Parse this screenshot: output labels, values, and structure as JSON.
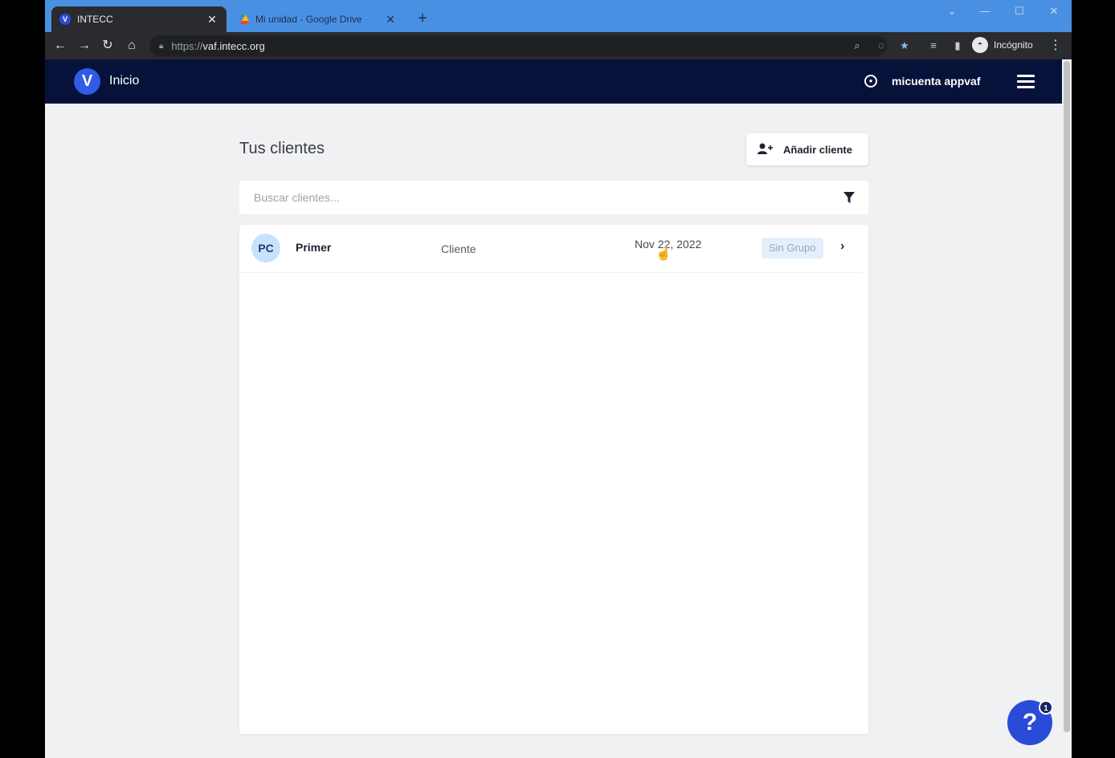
{
  "browser": {
    "tabs": [
      {
        "title": "INTECC",
        "favicon": "V"
      },
      {
        "title": "Mi unidad - Google Drive"
      }
    ],
    "url": {
      "protocol": "https://",
      "host": "vaf.intecc.org"
    },
    "incognito_label": "Incógnito"
  },
  "app": {
    "logo_letter": "V",
    "title": "Inicio",
    "user_name": "micuenta appvaf"
  },
  "main": {
    "page_title": "Tus clientes",
    "add_button_label": "Añadir cliente",
    "search_placeholder": "Buscar clientes...",
    "clients": [
      {
        "initials": "PC",
        "name": "Primer",
        "type": "Cliente",
        "date": "Nov 22, 2022",
        "group": "Sin Grupo"
      }
    ]
  },
  "help": {
    "label": "?",
    "badge": "1"
  },
  "colors": {
    "app_header": "#07123a",
    "accent": "#2a4bd8",
    "tab_strip": "#4a90e2"
  }
}
